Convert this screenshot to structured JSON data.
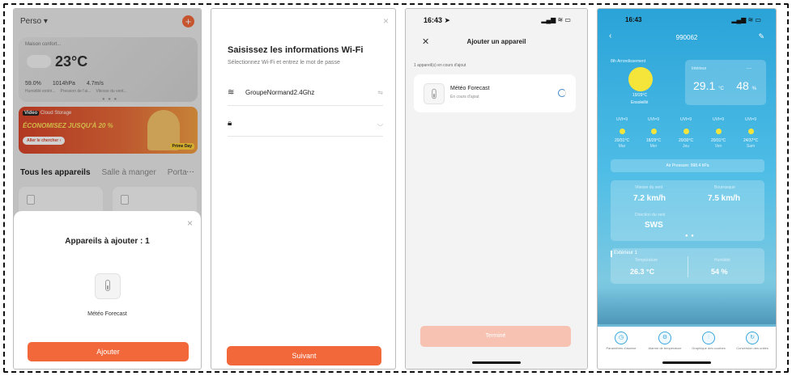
{
  "p1": {
    "home_label": "Perso ▾",
    "add_icon": "+",
    "weather": {
      "home": "Maison confort...",
      "temp": "23°C",
      "humidity": "59.0%",
      "pressure": "1014hPa",
      "wind": "4.7m/s",
      "humidity_label": "Humidité extéri...",
      "pressure_label": "Pression de l'ai...",
      "wind_label": "Vitesse du vent..."
    },
    "promo": {
      "tag_brand": "Video",
      "tag_text": "Cloud Storage",
      "title": "ÉCONOMISEZ JUSQU'À 20 %",
      "cta": "Aller le chercher ›",
      "badge": "Prime Day"
    },
    "tabs": [
      "Tous les appareils",
      "Salle à manger",
      "Porta"
    ],
    "more": "···",
    "sheet": {
      "close": "×",
      "title": "Appareils à ajouter : 1",
      "device_name": "Météo Forecast",
      "button": "Ajouter"
    }
  },
  "p2": {
    "close": "×",
    "title": "Saisissez les informations Wi-Fi",
    "subtitle": "Sélectionnez Wi-Fi et entrez le mot de passe",
    "ssid": "GroupeNormand2.4Ghz",
    "password_placeholder": "",
    "button": "Suivant"
  },
  "p3": {
    "time": "16:43 ➤",
    "status": "▂▄▆ ≋ ▭",
    "title": "Ajouter un appareil",
    "count": "1 appareil(s) en cours d'ajout",
    "device_name": "Météo Forecast",
    "device_status": "En cours d'ajout",
    "button": "Terminé"
  },
  "p4": {
    "time": "16:43",
    "status": "▂▄▆ ≋ ▭",
    "title": "990062",
    "location": "8th Arrondissement",
    "range": "19/29°C",
    "condition": "Ensoleillé",
    "indoor_label": "Intérieur",
    "indoor_dash": "----",
    "indoor_temp": "29.1",
    "indoor_temp_unit": "°C",
    "indoor_hum": "48",
    "indoor_hum_unit": "%",
    "forecast": [
      {
        "uv": "UVI=9",
        "range": "20/31°C",
        "day": "Mar"
      },
      {
        "uv": "UVI=9",
        "range": "18/29°C",
        "day": "Mer"
      },
      {
        "uv": "UVI=9",
        "range": "20/30°C",
        "day": "Jeu"
      },
      {
        "uv": "UVI=9",
        "range": "20/31°C",
        "day": "Ven"
      },
      {
        "uv": "UVI=9",
        "range": "24/37°C",
        "day": "Sam"
      }
    ],
    "pressure": "Air Pressure: 998.4 hPa",
    "wind_speed_label": "Vitesse du vent",
    "wind_speed": "7.2 km/h",
    "gust_label": "Bourrasque",
    "gust": "7.5 km/h",
    "wind_dir_label": "Direction du vent",
    "wind_dir": "SWS",
    "ext_title": "Extérieur 1",
    "ext_temp_label": "Température",
    "ext_temp": "26.3 °C",
    "ext_hum_label": "Humidité",
    "ext_hum": "54 %",
    "nav": [
      {
        "icon": "◷",
        "label": "Paramètres d'alarme"
      },
      {
        "icon": "⚙",
        "label": "Alarme de température"
      },
      {
        "icon": "⫶",
        "label": "Graphique des courbes"
      },
      {
        "icon": "↻",
        "label": "Conversion des unités"
      }
    ]
  }
}
